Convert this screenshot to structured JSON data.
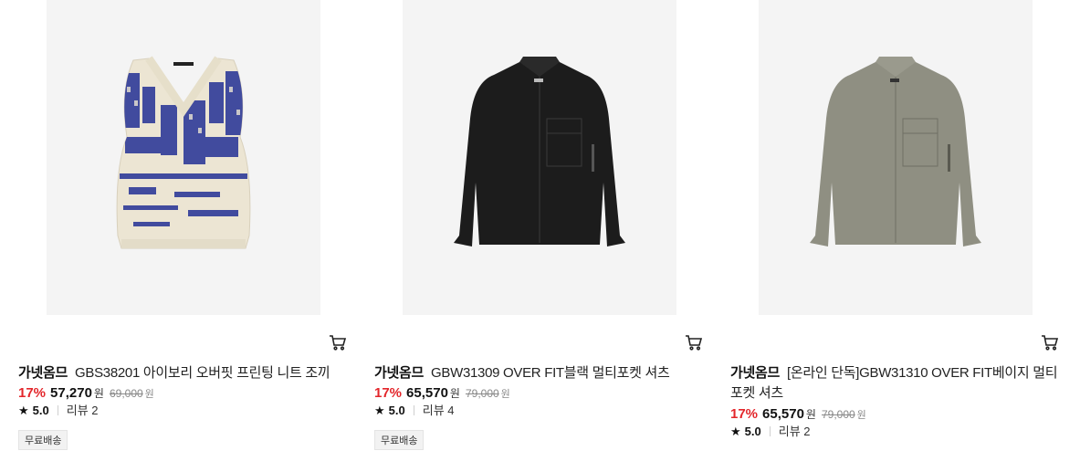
{
  "products": [
    {
      "brand": "가넷옴므",
      "name": "GBS38201 아이보리 오버핏 프린팅 니트 조끼",
      "discount": "17%",
      "price": "57,270",
      "currency": "원",
      "original_price": "69,000",
      "original_currency": "원",
      "star": "★",
      "rating": "5.0",
      "reviews": "리뷰 2",
      "badge": "무료배송",
      "image_icon": "knit-vest-image",
      "cart_icon": "cart-icon"
    },
    {
      "brand": "가넷옴므",
      "name": "GBW31309 OVER FIT블랙 멀티포켓 셔츠",
      "discount": "17%",
      "price": "65,570",
      "currency": "원",
      "original_price": "79,000",
      "original_currency": "원",
      "star": "★",
      "rating": "5.0",
      "reviews": "리뷰 4",
      "badge": "무료배송",
      "image_icon": "black-shirt-image",
      "cart_icon": "cart-icon"
    },
    {
      "brand": "가넷옴므",
      "name": "[온라인 단독]GBW31310 OVER FIT베이지 멀티포켓 셔츠",
      "discount": "17%",
      "price": "65,570",
      "currency": "원",
      "original_price": "79,000",
      "original_currency": "원",
      "star": "★",
      "rating": "5.0",
      "reviews": "리뷰 2",
      "image_icon": "beige-shirt-image",
      "cart_icon": "cart-icon"
    }
  ],
  "colors": {
    "discount": "#e3262b",
    "image_bg": "#f4f4f4",
    "vest_cream": "#ece5d3",
    "vest_print": "#2f3a98",
    "black_shirt": "#1c1c1c",
    "beige_shirt": "#8f8f82"
  }
}
